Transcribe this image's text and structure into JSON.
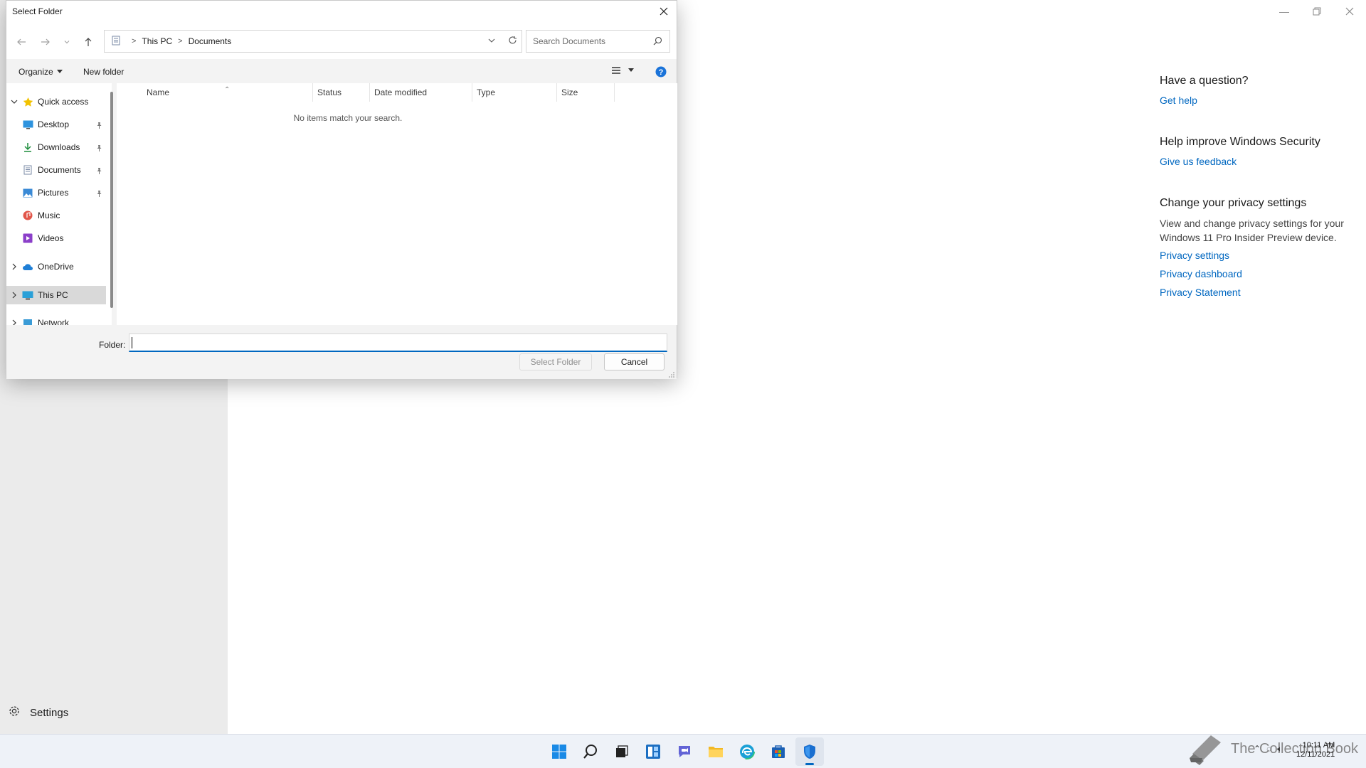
{
  "dialog": {
    "title": "Select Folder",
    "breadcrumb": [
      "This PC",
      "Documents"
    ],
    "search_placeholder": "Search Documents",
    "organize_label": "Organize",
    "new_folder_label": "New folder",
    "nav_items": [
      {
        "label": "Quick access",
        "icon": "star-icon",
        "expanded": true
      },
      {
        "label": "Desktop",
        "icon": "desktop-icon",
        "pinned": true
      },
      {
        "label": "Downloads",
        "icon": "download-icon",
        "pinned": true
      },
      {
        "label": "Documents",
        "icon": "documents-icon",
        "pinned": true
      },
      {
        "label": "Pictures",
        "icon": "pictures-icon",
        "pinned": true
      },
      {
        "label": "Music",
        "icon": "music-icon"
      },
      {
        "label": "Videos",
        "icon": "videos-icon"
      },
      {
        "label": "OneDrive",
        "icon": "cloud-icon"
      },
      {
        "label": "This PC",
        "icon": "pc-icon",
        "selected": true
      },
      {
        "label": "Network",
        "icon": "network-icon"
      }
    ],
    "columns": [
      "Name",
      "Status",
      "Date modified",
      "Type",
      "Size"
    ],
    "empty_message": "No items match your search.",
    "folder_label": "Folder:",
    "folder_value": "",
    "select_button": "Select Folder",
    "cancel_button": "Cancel"
  },
  "background_app": {
    "settings_label": "Settings",
    "right_panel": {
      "question_heading": "Have a question?",
      "get_help": "Get help",
      "improve_heading": "Help improve Windows Security",
      "feedback": "Give us feedback",
      "privacy_heading": "Change your privacy settings",
      "privacy_text": "View and change privacy settings for your Windows 11 Pro Insider Preview device.",
      "privacy_settings": "Privacy settings",
      "privacy_dashboard": "Privacy dashboard",
      "privacy_statement": "Privacy Statement"
    }
  },
  "taskbar": {
    "apps": [
      "start-icon",
      "search-icon",
      "task-view-icon",
      "widgets-icon",
      "teams-chat-icon",
      "file-explorer-icon",
      "edge-icon",
      "store-icon",
      "windows-security-icon"
    ],
    "time": "10:11 AM",
    "date": "12/11/2021",
    "watermark": "The Collection Book"
  },
  "colors": {
    "accent": "#0067c0",
    "sidebar": "#ebebeb",
    "taskbar": "#eef2f8"
  }
}
